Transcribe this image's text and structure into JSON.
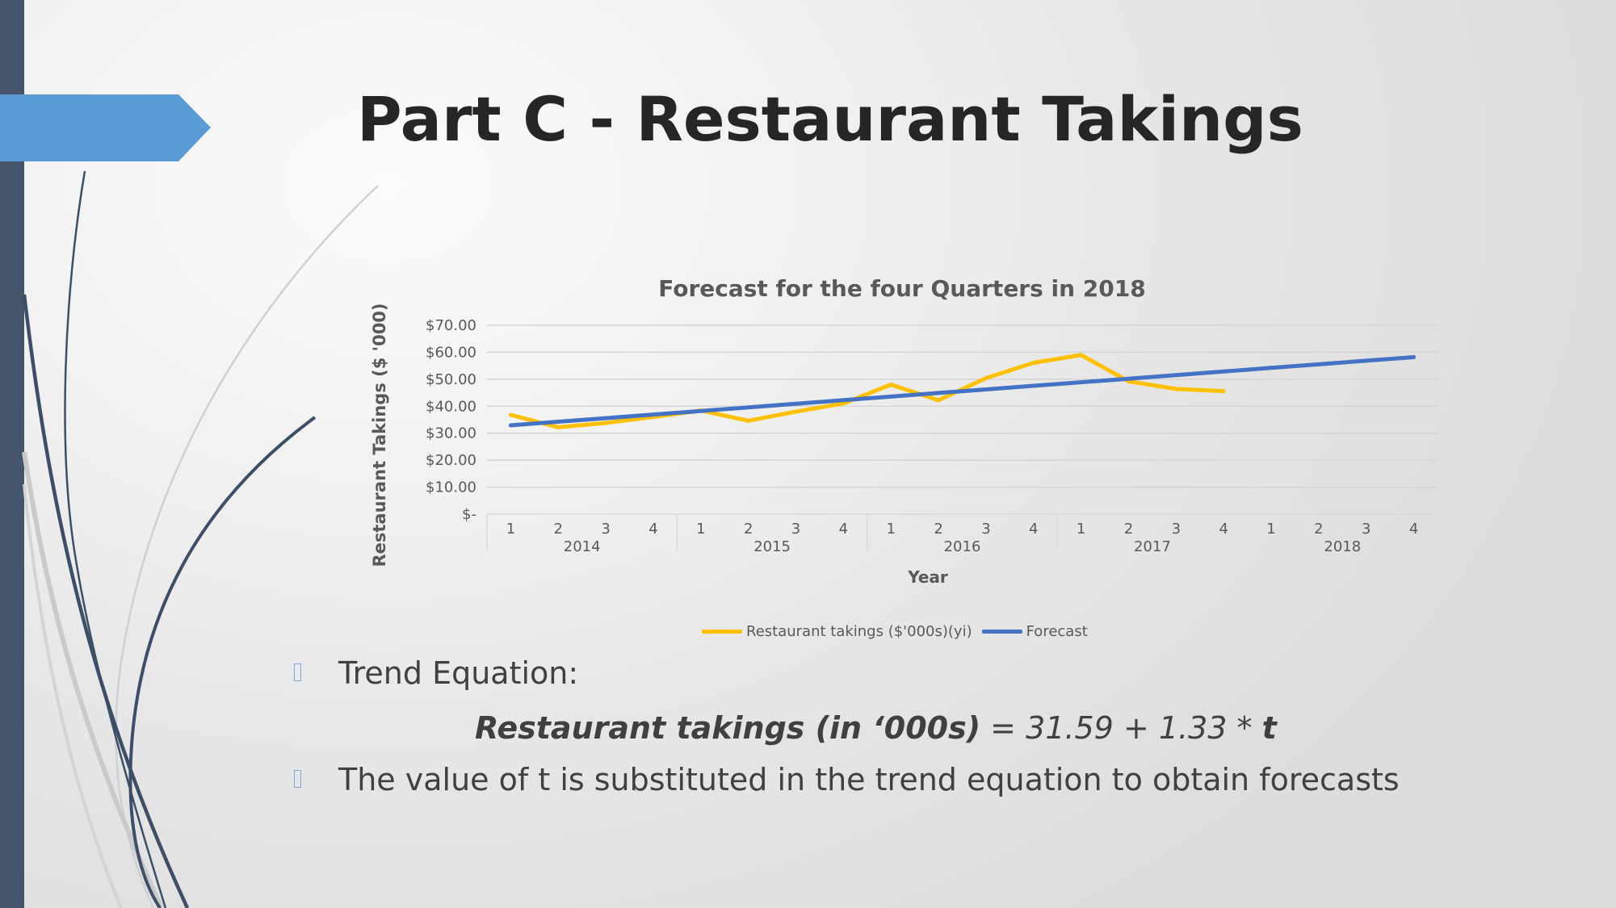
{
  "slide": {
    "title": "Part C - Restaurant Takings",
    "accent_color": "#5b9bd5",
    "sidebar_color": "#44546a"
  },
  "chart_data": {
    "type": "line",
    "title": "Forecast for the four Quarters in 2018",
    "xlabel": "Year",
    "ylabel": "Restaurant Takings ($ '000)",
    "ylim": [
      0,
      70
    ],
    "yticks": [
      0,
      10,
      20,
      30,
      40,
      50,
      60,
      70
    ],
    "ytick_labels": [
      "$-",
      "$10.00",
      "$20.00",
      "$30.00",
      "$40.00",
      "$50.00",
      "$60.00",
      "$70.00"
    ],
    "grid": true,
    "legend_position": "bottom",
    "year_groups": [
      "2014",
      "2015",
      "2016",
      "2017",
      "2018"
    ],
    "quarters": [
      "1",
      "2",
      "3",
      "4"
    ],
    "categories": [
      "2014 Q1",
      "2014 Q2",
      "2014 Q3",
      "2014 Q4",
      "2015 Q1",
      "2015 Q2",
      "2015 Q3",
      "2015 Q4",
      "2016 Q1",
      "2016 Q2",
      "2016 Q3",
      "2016 Q4",
      "2017 Q1",
      "2017 Q2",
      "2017 Q3",
      "2017 Q4",
      "2018 Q1",
      "2018 Q2",
      "2018 Q3",
      "2018 Q4"
    ],
    "series": [
      {
        "name": "Restaurant takings ($'000s)(yi)",
        "color": "#ffc000",
        "values": [
          36.8,
          32.2,
          33.8,
          36.0,
          38.4,
          34.6,
          38.0,
          41.0,
          48.0,
          42.2,
          50.4,
          56.1,
          59.0,
          49.2,
          46.4,
          45.6,
          null,
          null,
          null,
          null
        ]
      },
      {
        "name": "Forecast",
        "color": "#4472c4",
        "values": [
          32.92,
          34.25,
          35.58,
          36.91,
          38.24,
          39.57,
          40.9,
          42.23,
          43.56,
          44.89,
          46.22,
          47.55,
          48.88,
          50.21,
          51.54,
          52.87,
          54.2,
          55.53,
          56.86,
          58.19
        ]
      }
    ]
  },
  "body": {
    "bullets": [
      {
        "text": "Trend Equation:"
      },
      {
        "text": "The value of t is substituted in the trend equation to obtain forecasts"
      }
    ],
    "equation": {
      "lhs": "Restaurant takings (in ‘000s)",
      "middle": " = 31.59 + 1.33 * ",
      "variable": "t"
    }
  }
}
